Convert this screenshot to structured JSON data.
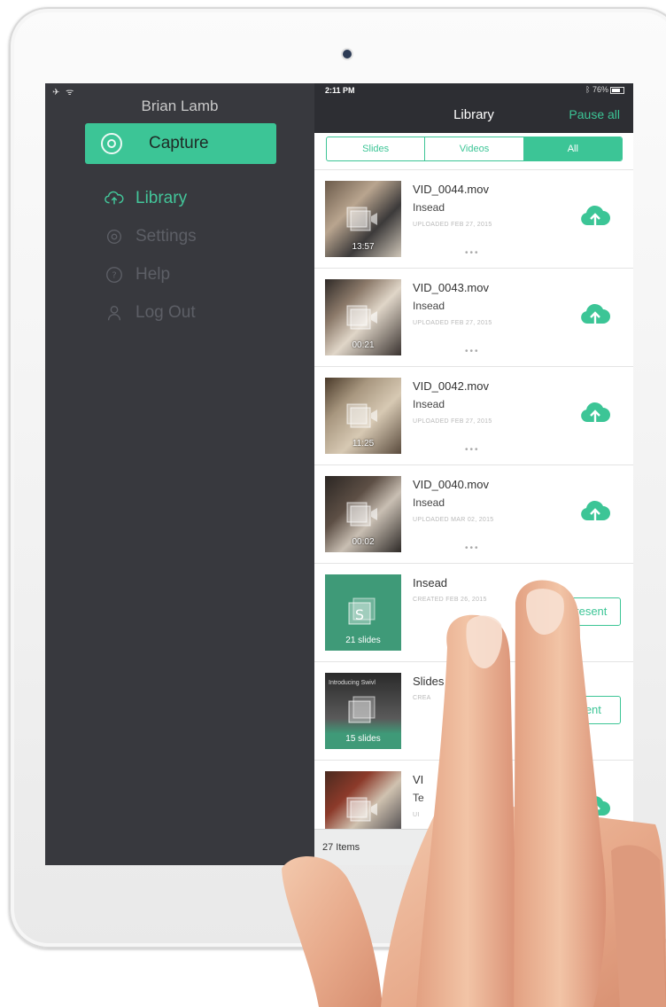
{
  "sidebar": {
    "user_name": "Brian Lamb",
    "capture_label": "Capture",
    "menu": [
      {
        "label": "Library",
        "icon": "cloud-upload-icon",
        "active": true
      },
      {
        "label": "Settings",
        "icon": "gear-icon",
        "active": false
      },
      {
        "label": "Help",
        "icon": "help-icon",
        "active": false
      },
      {
        "label": "Log Out",
        "icon": "user-icon",
        "active": false
      }
    ]
  },
  "status": {
    "time": "2:11 PM",
    "battery": "76%"
  },
  "header": {
    "title": "Library",
    "pause_all": "Pause all"
  },
  "tabs": [
    "Slides",
    "Videos",
    "All"
  ],
  "active_tab": "All",
  "items": [
    {
      "title": "VID_0044.mov",
      "subtitle": "Insead",
      "meta": "UPLOADED FEB 27, 2015",
      "duration": "13:57",
      "action": "upload"
    },
    {
      "title": "VID_0043.mov",
      "subtitle": "Insead",
      "meta": "UPLOADED FEB 27, 2015",
      "duration": "00:21",
      "action": "upload"
    },
    {
      "title": "VID_0042.mov",
      "subtitle": "Insead",
      "meta": "UPLOADED FEB 27, 2015",
      "duration": "11:25",
      "action": "upload"
    },
    {
      "title": "VID_0040.mov",
      "subtitle": "Insead",
      "meta": "UPLOADED MAR 02, 2015",
      "duration": "00:02",
      "action": "upload"
    },
    {
      "title": "Insead",
      "meta": "CREATED FEB 26, 2015",
      "slides": "21 slides",
      "action_label": "Present"
    },
    {
      "title": "Slides",
      "meta": "CREA",
      "slides": "15 slides",
      "thumb_text": "Introducing Swivl",
      "action_label": "esent"
    },
    {
      "title": "VI",
      "subtitle": "Te",
      "meta": "UI",
      "action": "upload"
    }
  ],
  "footer": {
    "count": "27 Items"
  },
  "colors": {
    "accent": "#3cc596",
    "sidebar": "#38393e",
    "topbar": "#2d2e33"
  }
}
